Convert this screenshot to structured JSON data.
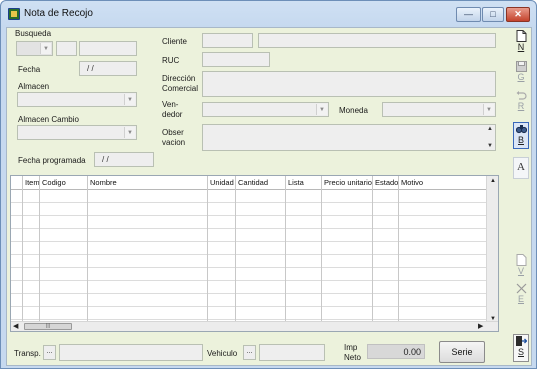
{
  "window": {
    "title": "Nota de Recojo"
  },
  "form": {
    "busqueda_label": "Busqueda",
    "fecha_label": "Fecha",
    "fecha_value": "/ /",
    "almacen_label": "Almacen",
    "almacen_cambio_label": "Almacen Cambio",
    "fecha_programada_label": "Fecha programada",
    "fecha_programada_value": "/ /",
    "cliente_label": "Cliente",
    "ruc_label": "RUC",
    "direccion_label_1": "Dirección",
    "direccion_label_2": "Comercial",
    "vendedor_label_1": "Ven-",
    "vendedor_label_2": "dedor",
    "moneda_label": "Moneda",
    "observacion_label_1": "Obser",
    "observacion_label_2": "vacion"
  },
  "grid": {
    "columns": [
      "Item",
      "Codigo",
      "Nombre",
      "Unidad",
      "Cantidad",
      "Lista",
      "Precio unitario",
      "Estado",
      "Motivo"
    ],
    "hscroll_thumb": "|||"
  },
  "footer": {
    "transp_label": "Transp.",
    "transp_btn": "...",
    "vehiculo_label": "Vehiculo",
    "vehiculo_btn": "...",
    "imp_label_1": "Imp",
    "imp_label_2": "Neto",
    "imp_value": "0.00",
    "serie_btn": "Serie"
  },
  "toolbar": {
    "nuevo": "N",
    "guardar": "G",
    "revertir": "R",
    "buscar": "B",
    "fuente": "A",
    "ver": "V",
    "eliminar": "E",
    "salir": "S"
  }
}
